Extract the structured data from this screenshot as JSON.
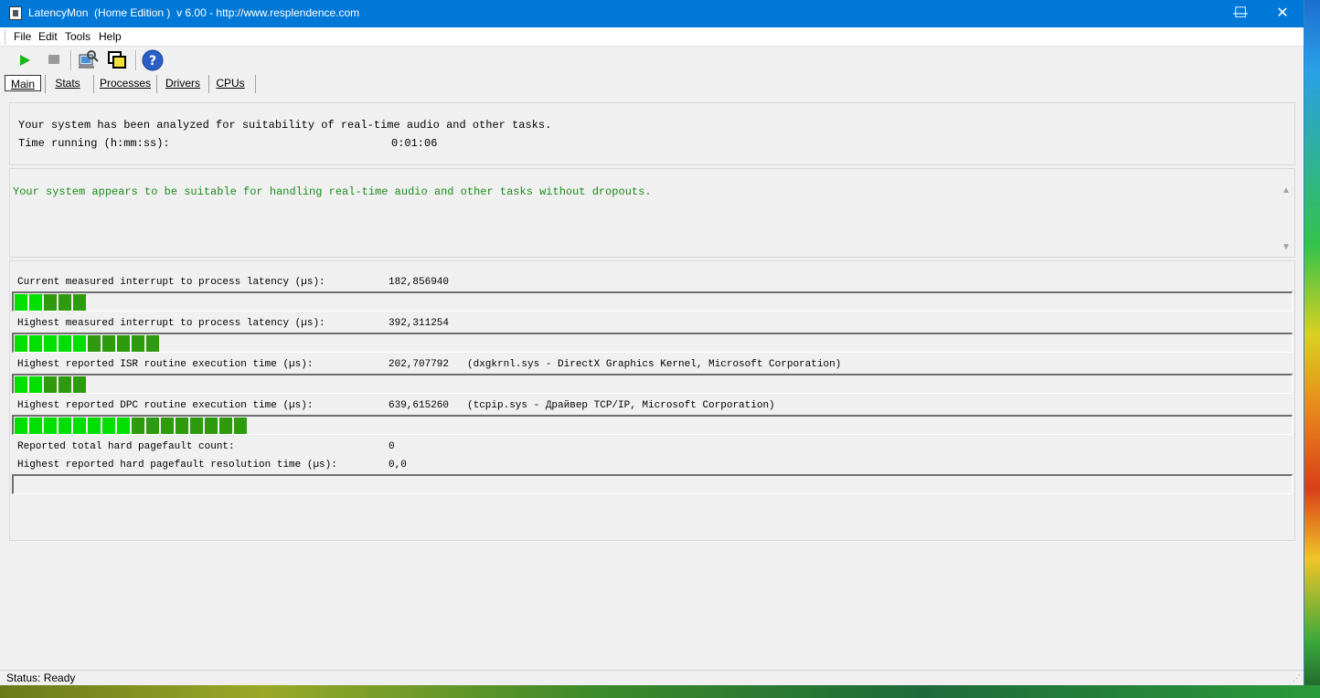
{
  "window": {
    "title": "LatencyMon  (Home Edition )  v 6.00 - http://www.resplendence.com",
    "minimize": "—",
    "maximize": "☐",
    "close": "✕"
  },
  "menu": {
    "items": [
      "File",
      "Edit",
      "Tools",
      "Help"
    ]
  },
  "toolbar": {
    "icons": [
      "play-icon",
      "stop-icon",
      "analyze-icon",
      "window-icon",
      "help-icon"
    ]
  },
  "tabs": [
    "Main",
    "Stats",
    "Processes",
    "Drivers",
    "CPUs"
  ],
  "summary": {
    "line1": "Your system has been analyzed for suitability of real-time audio and other tasks.",
    "time_label": "Time running (h:mm:ss):",
    "time_value": "0:01:06"
  },
  "verdict": {
    "text": "Your system appears to be suitable for handling real-time audio and other tasks without dropouts."
  },
  "metrics": [
    {
      "label": "Current measured interrupt to process latency (µs):",
      "value": "182,856940",
      "detail": "",
      "bar_segments": 5
    },
    {
      "label": "Highest measured interrupt to process latency (µs):",
      "value": "392,311254",
      "detail": "",
      "bar_segments": 10
    },
    {
      "label": "Highest reported ISR routine execution time (µs):",
      "value": "202,707792",
      "detail": "(dxgkrnl.sys - DirectX Graphics Kernel, Microsoft Corporation)",
      "bar_segments": 5
    },
    {
      "label": "Highest reported DPC routine execution time (µs):",
      "value": "639,615260",
      "detail": "(tcpip.sys - Драйвер TCP/IP, Microsoft Corporation)",
      "bar_segments": 16
    }
  ],
  "pagefault": {
    "count_label": "Reported total hard pagefault count:",
    "count_value": "0",
    "time_label": "Highest reported hard pagefault resolution time (µs):",
    "time_value": "0,0",
    "bar_segments": 0
  },
  "status": {
    "text": "Status: Ready"
  },
  "colors": {
    "titlebar": "#0078d7",
    "bar_bright": "#00e000",
    "bar_dark": "#2e9a0e",
    "verdict_text": "#1a8c1a"
  }
}
